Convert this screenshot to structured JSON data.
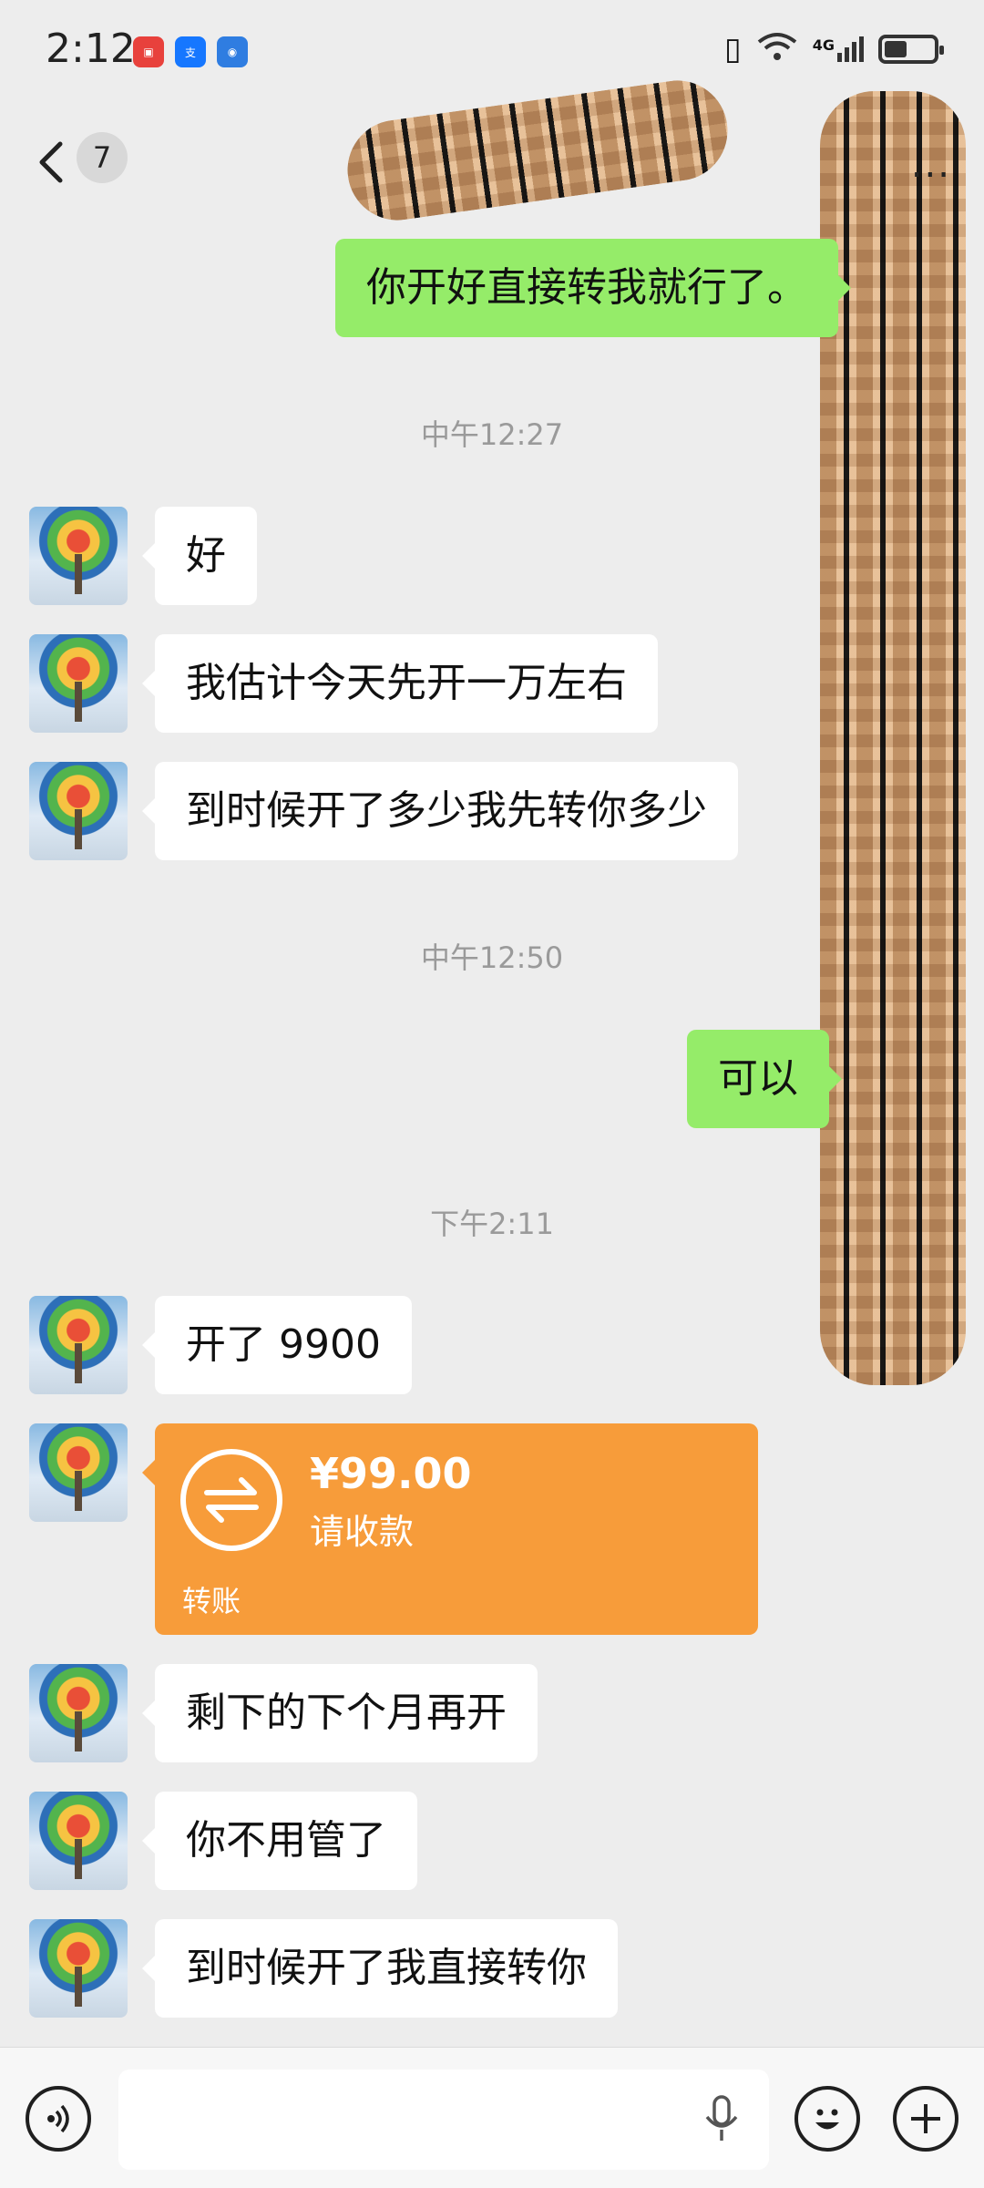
{
  "status_bar": {
    "time": "2:12",
    "app_icons": [
      "huawei-store-icon",
      "alipay-icon",
      "browser-icon"
    ],
    "network": "4G"
  },
  "header": {
    "unread_count": "7",
    "more_label": "..."
  },
  "messages": [
    {
      "text": "你开好直接转我就行了。"
    },
    {
      "timestamp": "中午12:27"
    },
    {
      "text": "好"
    },
    {
      "text": "我估计今天先开一万左右"
    },
    {
      "text": "到时候开了多少我先转你多少"
    },
    {
      "timestamp": "中午12:50"
    },
    {
      "text": "可以"
    },
    {
      "timestamp": "下午2:11"
    },
    {
      "text": "开了 9900"
    },
    {
      "transfer": {
        "amount": "¥99.00",
        "status": "请收款",
        "label": "转账"
      }
    },
    {
      "text": "剩下的下个月再开"
    },
    {
      "text": "你不用管了"
    },
    {
      "text": "到时候开了我直接转你"
    }
  ],
  "input_bar": {
    "value": "",
    "icons": [
      "voice-toggle-icon",
      "microphone-icon",
      "emoji-icon",
      "plus-icon"
    ]
  },
  "colors": {
    "outgoing_bubble": "#95ec69",
    "incoming_bubble": "#ffffff",
    "transfer_card": "#f79c3a",
    "background": "#ededed"
  }
}
